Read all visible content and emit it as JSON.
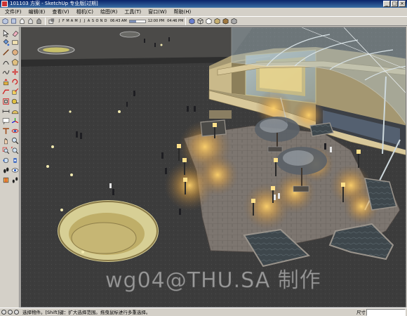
{
  "window": {
    "title": "101103 方案 - SketchUp 专业版[过期]",
    "controls": [
      "_",
      "□",
      "×"
    ]
  },
  "menu": [
    "文件(F)",
    "编辑(E)",
    "查看(V)",
    "相机(C)",
    "绘图(R)",
    "工具(T)",
    "窗口(W)",
    "帮助(H)"
  ],
  "toolbar": {
    "months": [
      "J",
      "F",
      "M",
      "A",
      "M",
      "J",
      "J",
      "A",
      "S",
      "O",
      "N",
      "D"
    ],
    "time_start": "06:43 AM",
    "time_noon": "12:00 PM",
    "time_end": "04:46 PM"
  },
  "viewport": {
    "watermark": "wg04@THU.SA 制作"
  },
  "status": {
    "message": "选择物件。[Shift]键：扩大选择范围。拖曳鼠标进行多重选择。",
    "measurements_label": "尺寸",
    "measurements_value": ""
  },
  "icons": [
    "select-icon",
    "eraser-icon",
    "rectangle-icon",
    "line-icon",
    "circle-icon",
    "arc-icon",
    "polygon-icon",
    "freehand-icon",
    "move-icon",
    "pushpull-icon",
    "rotate-icon",
    "followme-icon",
    "scale-icon",
    "offset-icon",
    "tape-icon",
    "dimension-icon",
    "protractor-icon",
    "text-icon",
    "axes-icon",
    "3dtext-icon",
    "orbit-icon",
    "pan-icon",
    "zoom-icon",
    "zoomwindow-icon",
    "zoomextents-icon",
    "previous-icon",
    "position-camera-icon",
    "walk-icon",
    "lookaround-icon",
    "section-icon"
  ],
  "colors": {
    "window_bg": "#d4d0c8",
    "titlebar": "#0a246a",
    "ground": "#3a3a3a",
    "plaza": "#7d7670",
    "lamp_glow": "#ffd26a",
    "glass": "#9fb6bf",
    "building": "#c9b98a"
  }
}
